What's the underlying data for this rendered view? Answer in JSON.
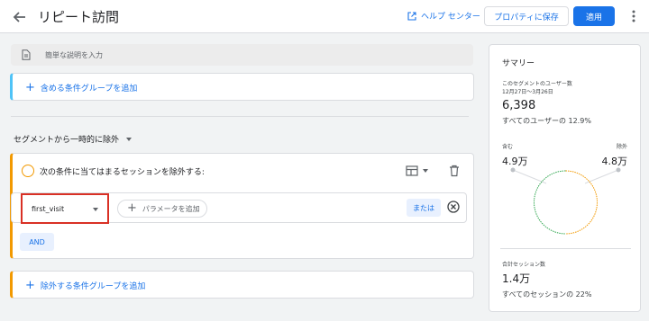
{
  "header": {
    "title": "リピート訪問",
    "help_label": "ヘルプ センター",
    "save_label": "プロパティに保存",
    "apply_label": "適用"
  },
  "description": {
    "placeholder": "簡単な説明を入力"
  },
  "include_group": {
    "add_label": "含める条件グループを追加"
  },
  "exclude_section": {
    "dropdown_label": "セグメントから一時的に除外",
    "condition_title": "次の条件に当てはまるセッションを除外する:",
    "event_name": "first_visit",
    "add_param_label": "パラメータを追加",
    "or_label": "または",
    "and_label": "AND",
    "add_group_label": "除外する条件グループを追加"
  },
  "summary": {
    "title": "サマリー",
    "users_label": "このセグメントのユーザー数",
    "date_range": "12月27日～3月26日",
    "users_value": "6,398",
    "users_pct": "すべてのユーザーの 12.9%",
    "include_label": "含む",
    "exclude_label": "除外",
    "include_value": "4.9万",
    "exclude_value": "4.8万",
    "sessions_label": "合計セッション数",
    "sessions_value": "1.4万",
    "sessions_pct": "すべてのセッションの 22%"
  },
  "colors": {
    "accent": "#1a73e8",
    "exclude_accent": "#f29900",
    "include_accent": "#4fc3f7",
    "highlight": "#d93025",
    "ring_include": "#34a853",
    "ring_exclude": "#f29900"
  }
}
